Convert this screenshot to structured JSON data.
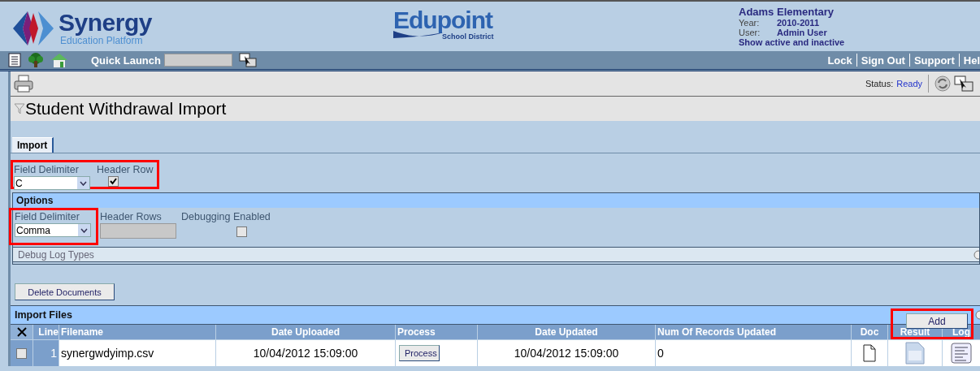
{
  "header": {
    "brand": "Synergy",
    "tagline": "Education Platform",
    "district_logo": "Edupoint",
    "district_sub": "School District",
    "school": "Adams Elementary",
    "year_label": "Year:",
    "year": "2010-2011",
    "user_label": "User:",
    "user": "Admin User",
    "filter_link": "Show active and inactive"
  },
  "navbar": {
    "quick_launch": "Quick Launch",
    "links": [
      "Lock",
      "Sign Out",
      "Support",
      "Hel"
    ]
  },
  "toolbar": {
    "status_label": "Status:",
    "status": "Ready"
  },
  "page_title": "Student Withdrawal Import",
  "tabs": [
    {
      "label": "Import",
      "selected": true
    }
  ],
  "import_fields": {
    "delimiter_label": "Field Delimiter",
    "delimiter": "C",
    "header_row_label": "Header Row",
    "header_row_checked": true
  },
  "options": {
    "title": "Options",
    "delimiter_label": "Field Delimiter",
    "delimiter": "Comma",
    "header_rows_label": "Header Rows",
    "debugging_label": "Debugging Enabled",
    "debugging_checked": false,
    "debug_log_types": "Debug Log Types"
  },
  "delete_button": "Delete Documents",
  "import_files": {
    "title": "Import Files",
    "add_button": "Add",
    "columns": [
      "Line",
      "Filename",
      "Date Uploaded",
      "Process",
      "Date Updated",
      "Num Of Records Updated",
      "Doc",
      "Result",
      "Log"
    ],
    "rows": [
      {
        "checked": false,
        "line": "1",
        "filename": "synergwdyimp.csv",
        "date_uploaded": "10/04/2012 15:09:00",
        "process": "Process",
        "date_updated": "10/04/2012 15:09:00",
        "records": "0"
      }
    ]
  }
}
